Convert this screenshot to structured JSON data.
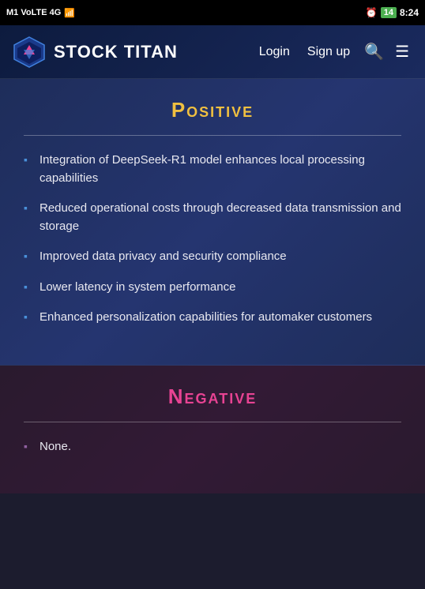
{
  "statusBar": {
    "left": "M1 VoLTE 4G",
    "icons": [
      "alarm-icon",
      "battery-icon",
      "time-icon"
    ],
    "battery": "14",
    "time": "8:24"
  },
  "navbar": {
    "logoText": "STOCK TITAN",
    "loginLabel": "Login",
    "signupLabel": "Sign up"
  },
  "positive": {
    "title": "Positive",
    "items": [
      "Integration of DeepSeek-R1 model enhances local processing capabilities",
      "Reduced operational costs through decreased data transmission and storage",
      "Improved data privacy and security compliance",
      "Lower latency in system performance",
      "Enhanced personalization capabilities for automaker customers"
    ]
  },
  "negative": {
    "title": "Negative",
    "items": [
      "None."
    ]
  }
}
